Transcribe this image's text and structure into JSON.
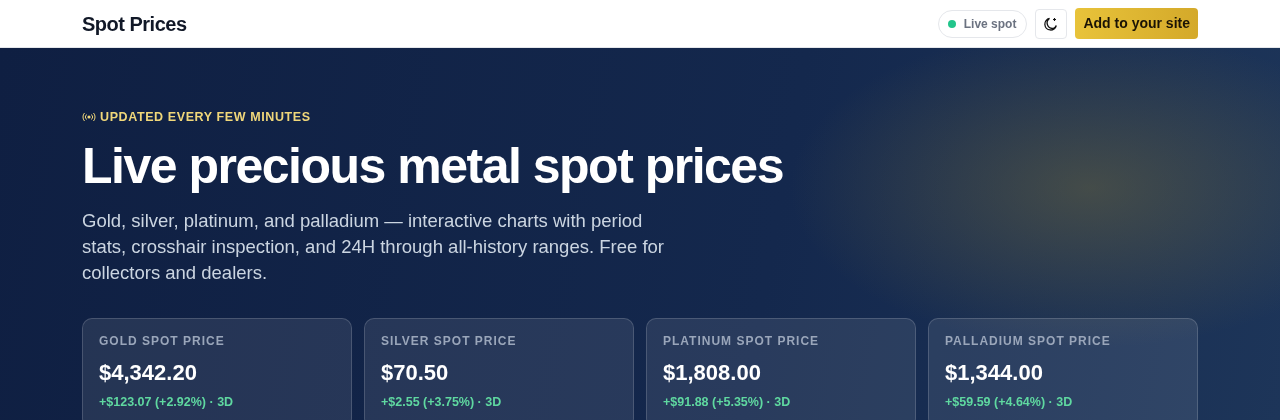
{
  "header": {
    "brand": "Spot Prices",
    "status": {
      "label": "Live spot",
      "live": true
    },
    "cta": "Add to your site"
  },
  "hero": {
    "eyebrow": "UPDATED EVERY FEW MINUTES",
    "title": "Live precious metal spot prices",
    "lead": "Gold, silver, platinum, and palladium — interactive charts with period stats, crosshair inspection, and 24H through all-history ranges. Free for collectors and dealers."
  },
  "cards": [
    {
      "label": "GOLD SPOT PRICE",
      "price": "$4,342.20",
      "change": "+$123.07 (+2.92%) · 3D",
      "positive": true
    },
    {
      "label": "SILVER SPOT PRICE",
      "price": "$70.50",
      "change": "+$2.55 (+3.75%) · 3D",
      "positive": true
    },
    {
      "label": "PLATINUM SPOT PRICE",
      "price": "$1,808.00",
      "change": "+$91.88 (+5.35%) · 3D",
      "positive": true
    },
    {
      "label": "PALLADIUM SPOT PRICE",
      "price": "$1,344.00",
      "change": "+$59.59 (+4.64%) · 3D",
      "positive": true
    }
  ]
}
